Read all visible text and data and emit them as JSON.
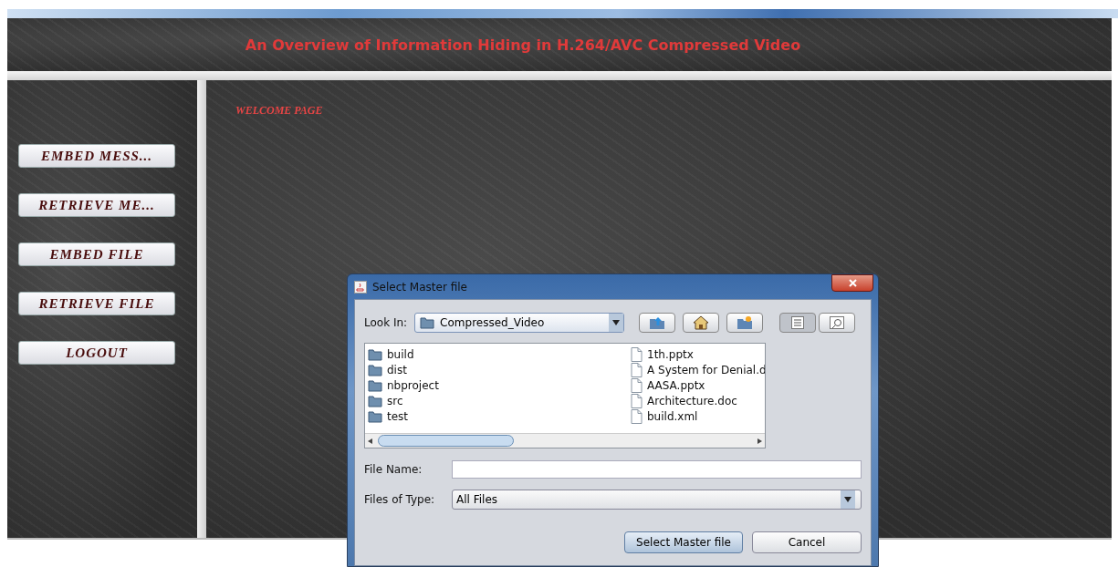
{
  "header": {
    "title": "An Overview of Information Hiding in H.264/AVC Compressed Video"
  },
  "sidebar": {
    "buttons": [
      {
        "label": "EMBED MESS..."
      },
      {
        "label": "RETRIEVE ME..."
      },
      {
        "label": "EMBED FILE"
      },
      {
        "label": "RETRIEVE FILE"
      },
      {
        "label": "LOGOUT"
      }
    ]
  },
  "main": {
    "heading": "WELCOME PAGE"
  },
  "dialog": {
    "title": "Select Master file",
    "look_in": {
      "label": "Look In:",
      "value": "Compressed_Video"
    },
    "toolbar_buttons": [
      {
        "kind": "up",
        "selected": false
      },
      {
        "kind": "home",
        "selected": false
      },
      {
        "kind": "new-folder",
        "selected": false
      },
      {
        "kind": "list",
        "selected": true
      },
      {
        "kind": "details",
        "selected": false
      }
    ],
    "files": [
      {
        "kind": "folder",
        "name": "build"
      },
      {
        "kind": "folder",
        "name": "dist"
      },
      {
        "kind": "folder",
        "name": "nbproject"
      },
      {
        "kind": "folder",
        "name": "src"
      },
      {
        "kind": "folder",
        "name": "test"
      },
      {
        "kind": "file",
        "name": "1th.pptx"
      },
      {
        "kind": "file",
        "name": "A System for Denial.d"
      },
      {
        "kind": "file",
        "name": "AASA.pptx"
      },
      {
        "kind": "file",
        "name": "Architecture.doc"
      },
      {
        "kind": "file",
        "name": "build.xml"
      }
    ],
    "file_name": {
      "label": "File Name:"
    },
    "file_type": {
      "label": "Files of Type:",
      "value": "All Files"
    },
    "buttons": [
      {
        "label": "Select Master file"
      },
      {
        "label": "Cancel"
      }
    ]
  }
}
